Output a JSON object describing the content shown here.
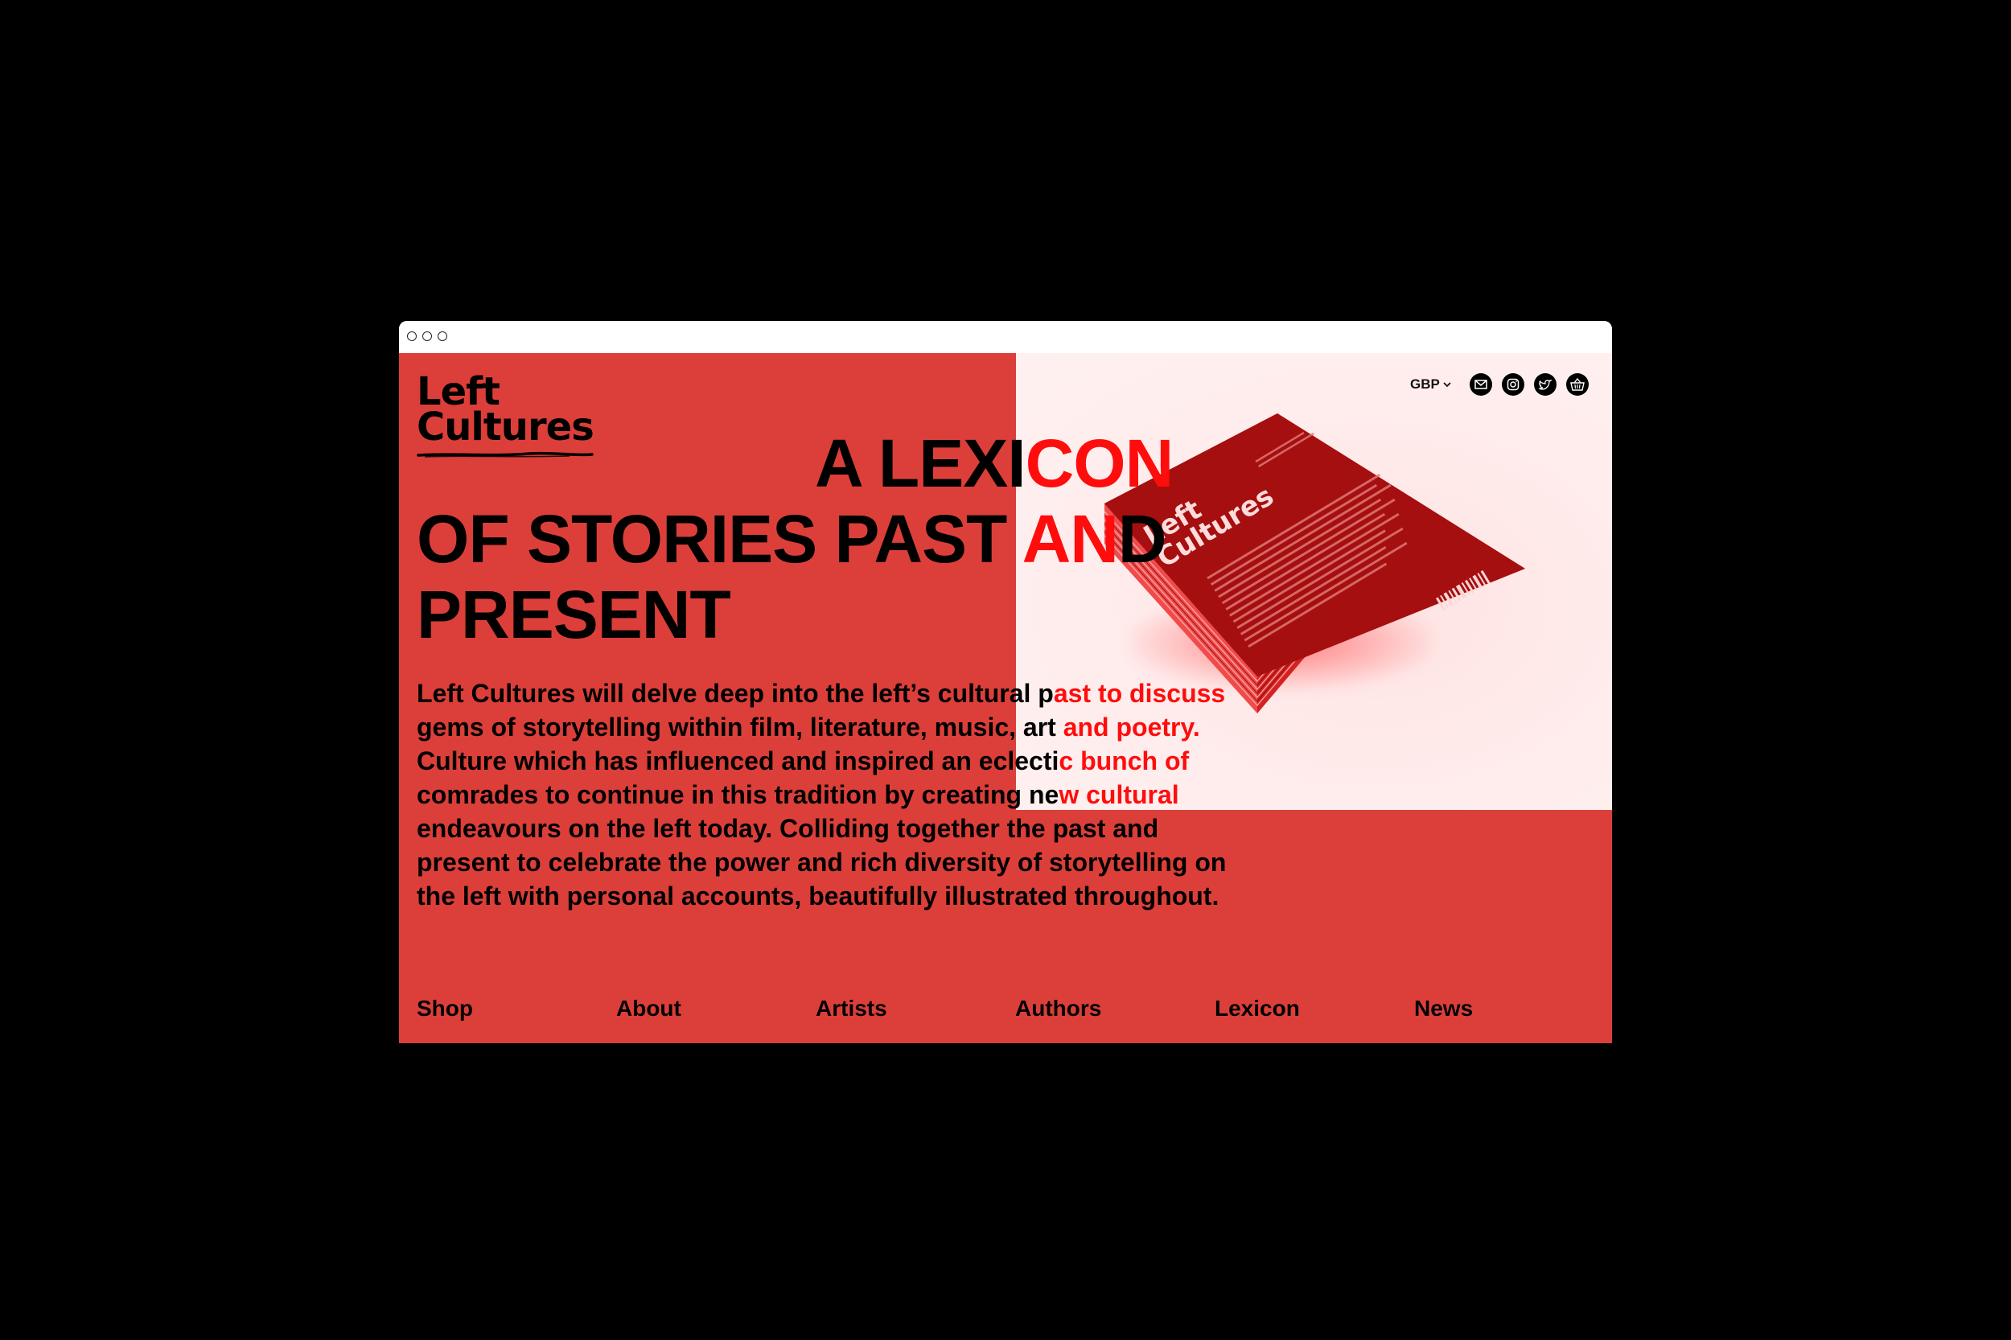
{
  "brand": {
    "line1": "Left",
    "line2": "Cultures"
  },
  "utility": {
    "currency": "GBP",
    "icons": [
      "mail-icon",
      "instagram-icon",
      "twitter-icon",
      "basket-icon"
    ]
  },
  "headline": {
    "line1_black": "A LEXI",
    "line1_red": "CON",
    "line2_black": "OF STORIES PAST ",
    "line2_red": "AN",
    "line2_tail": "D",
    "line3": "PRESENT"
  },
  "intro": [
    {
      "black": "Left Cultures will delve deep into the left’s cultural p",
      "red": "ast to discuss"
    },
    {
      "black": "gems of storytelling within film, literature, music, art",
      "red": " and poetry."
    },
    {
      "black": "Culture which has influenced and inspired an eclecti",
      "red": "c bunch of"
    },
    {
      "black": "comrades to continue in this tradition by creating ne",
      "red": "w cultural"
    },
    {
      "black": "endeavours on the left today. Colliding together the past and",
      "red": ""
    },
    {
      "black": "present to celebrate the power and rich diversity of storytelling on",
      "red": ""
    },
    {
      "black": "the left with personal accounts, beautifully illustrated throughout.",
      "red": ""
    }
  ],
  "nav": [
    "Shop",
    "About",
    "Artists",
    "Authors",
    "Lexicon",
    "News"
  ],
  "colors": {
    "page_red": "#dc3f39",
    "accent_red": "#ff0d0d",
    "magazine_red": "#a50f0f"
  }
}
